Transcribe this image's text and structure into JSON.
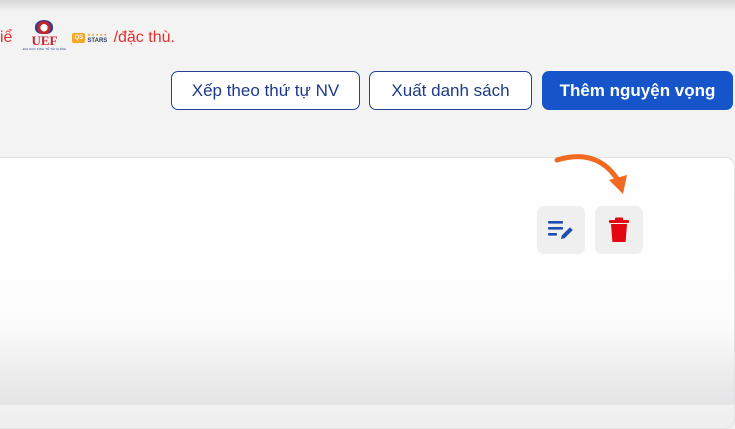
{
  "notice": {
    "left_text": "iể",
    "right_text": "/đặc thù.",
    "uef_logo": {
      "letters": "UEF",
      "small": "ĐẠI HỌC KINH TẾ TÀI CHÍNH"
    },
    "qs_logo": {
      "box": "QS",
      "word": "STARS"
    }
  },
  "toolbar": {
    "sort_label": "Xếp theo thứ tự NV",
    "export_label": "Xuất danh sách",
    "add_label": "Thêm nguyện vọng"
  },
  "row_actions": {
    "edit_icon": "edit-list-icon",
    "delete_icon": "trash-icon"
  },
  "colors": {
    "primary": "#1555c9",
    "outline": "#25418f",
    "danger": "#e30613",
    "notice": "#e5312d",
    "arrow": "#f26a21"
  }
}
